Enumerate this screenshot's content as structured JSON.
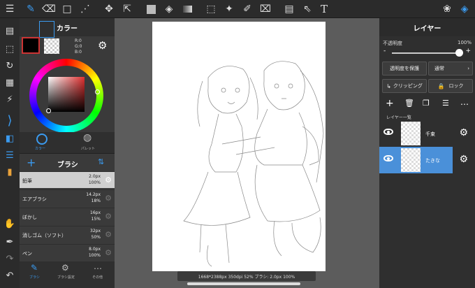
{
  "color_panel": {
    "title": "カラー",
    "r": "R:0",
    "g": "G:0",
    "b": "B:0",
    "tab_color": "カラー",
    "tab_palette": "パレット"
  },
  "brush_panel": {
    "title": "ブラシ",
    "items": [
      {
        "name": "鉛筆",
        "size": "2.0px",
        "opacity": "100%"
      },
      {
        "name": "エアブラシ",
        "size": "14.2px",
        "opacity": "18%"
      },
      {
        "name": "ぼかし",
        "size": "16px",
        "opacity": "15%"
      },
      {
        "name": "消しゴム（ソフト）",
        "size": "32px",
        "opacity": "50%"
      },
      {
        "name": "ペン",
        "size": "8.0px",
        "opacity": "100%"
      }
    ],
    "bottom_tabs": [
      "ブラシ",
      "ブラシ設定",
      "その他"
    ]
  },
  "status": "1668*2388px 350dpi 52% ブラシ: 2.0px 100%",
  "layer_panel": {
    "title": "レイヤー",
    "opacity_label": "不透明度",
    "opacity_value": "100%",
    "opacity_fraction": 1.0,
    "minus": "-",
    "plus": "+",
    "protect_btn": "透明度を保護",
    "blend_btn": "通常",
    "clipping_btn": "クリッピング",
    "lock_btn": "ロック",
    "list_label": "レイヤー一覧",
    "layers": [
      {
        "name": "千束",
        "selected": false
      },
      {
        "name": "たきな",
        "selected": true
      }
    ]
  },
  "toolbar": {
    "text_tool": "T"
  },
  "colors": {
    "accent": "#3b9bf0",
    "selected_layer": "#4a90d9"
  }
}
